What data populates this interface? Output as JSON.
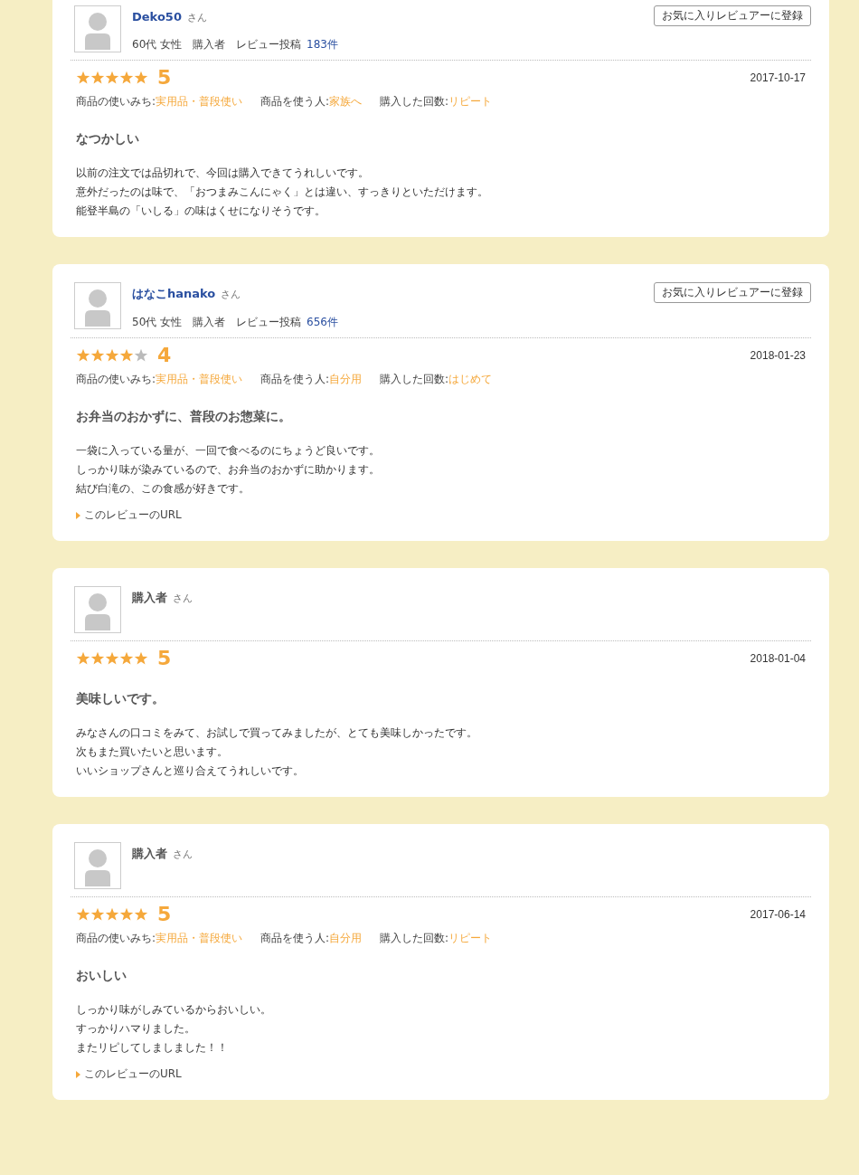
{
  "reviews": [
    {
      "reviewer": {
        "name": "Deko50",
        "linked": true,
        "honorific": "さん",
        "meta": "60代 女性　購入者　レビュー投稿",
        "post_count": "183件"
      },
      "favorite_button": "お気に入りレビュアーに登録",
      "stars": 5,
      "score": "5",
      "date": "2017-10-17",
      "attributes": [
        {
          "label": "商品の使いみち:",
          "value": "実用品・普段使い"
        },
        {
          "label": "商品を使う人:",
          "value": "家族へ"
        },
        {
          "label": "購入した回数:",
          "value": "リピート"
        }
      ],
      "title": "なつかしい",
      "body": [
        "以前の注文では品切れで、今回は購入できてうれしいです。",
        "意外だったのは味で、「おつまみこんにゃく」とは違い、すっきりといただけます。",
        "能登半島の「いしる」の味はくせになりそうです。"
      ]
    },
    {
      "reviewer": {
        "name": "はなこhanako",
        "linked": true,
        "honorific": "さん",
        "meta": "50代 女性　購入者　レビュー投稿",
        "post_count": "656件"
      },
      "favorite_button": "お気に入りレビュアーに登録",
      "stars": 4,
      "score": "4",
      "date": "2018-01-23",
      "attributes": [
        {
          "label": "商品の使いみち:",
          "value": "実用品・普段使い"
        },
        {
          "label": "商品を使う人:",
          "value": "自分用"
        },
        {
          "label": "購入した回数:",
          "value": "はじめて"
        }
      ],
      "title": "お弁当のおかずに、普段のお惣菜に。",
      "body": [
        "一袋に入っている量が、一回で食べるのにちょうど良いです。",
        "しっかり味が染みているので、お弁当のおかずに助かります。",
        "結び白滝の、この食感が好きです。"
      ],
      "url_link": "このレビューのURL"
    },
    {
      "reviewer": {
        "name": "購入者",
        "linked": false,
        "honorific": "さん"
      },
      "stars": 5,
      "score": "5",
      "date": "2018-01-04",
      "title": "美味しいです。",
      "body": [
        "みなさんの口コミをみて、お試しで買ってみましたが、とても美味しかったです。",
        "次もまた買いたいと思います。",
        "いいショップさんと巡り合えてうれしいです。"
      ]
    },
    {
      "reviewer": {
        "name": "購入者",
        "linked": false,
        "honorific": "さん"
      },
      "stars": 5,
      "score": "5",
      "date": "2017-06-14",
      "attributes": [
        {
          "label": "商品の使いみち:",
          "value": "実用品・普段使い"
        },
        {
          "label": "商品を使う人:",
          "value": "自分用"
        },
        {
          "label": "購入した回数:",
          "value": "リピート"
        }
      ],
      "title": "おいしい",
      "body": [
        "しっかり味がしみているからおいしい。",
        "すっかりハマりました。",
        "またリピしてしましました！！"
      ],
      "url_link": "このレビューのURL"
    }
  ]
}
